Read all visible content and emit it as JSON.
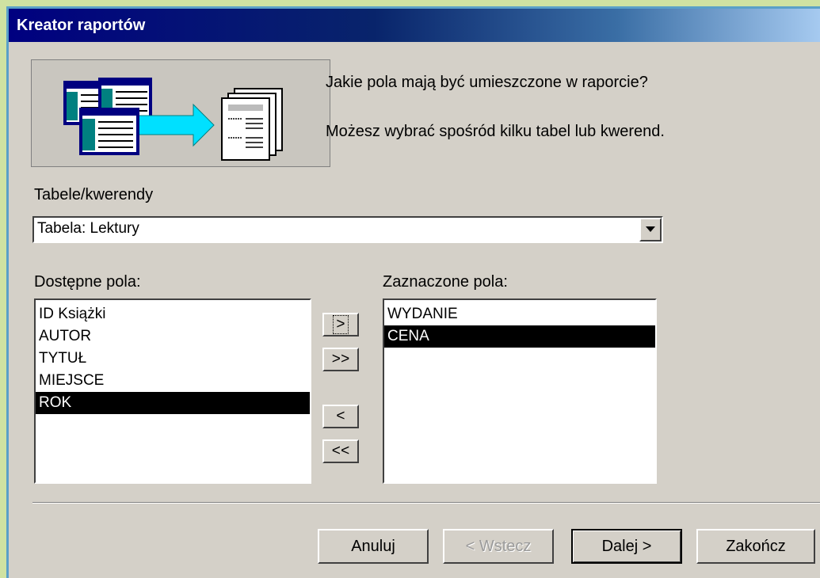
{
  "window": {
    "title": "Kreator raportów"
  },
  "header": {
    "question": "Jakie pola mają być umieszczone w raporcie?",
    "hint": "Możesz wybrać spośród kilku tabel lub kwerend."
  },
  "source": {
    "label": "Tabele/kwerendy",
    "value": "Tabela: Lektury"
  },
  "available": {
    "label": "Dostępne pola:",
    "items": [
      "ID Książki",
      "AUTOR",
      "TYTUŁ",
      "MIEJSCE",
      "ROK"
    ],
    "selected_index": 4
  },
  "chosen": {
    "label": "Zaznaczone pola:",
    "items": [
      "WYDANIE",
      "CENA"
    ],
    "selected_index": 1
  },
  "move_buttons": {
    "add_one": ">",
    "add_all": ">>",
    "remove_one": "<",
    "remove_all": "<<"
  },
  "footer": {
    "cancel": "Anuluj",
    "back": "< Wstecz",
    "next": "Dalej >",
    "finish": "Zakończ"
  }
}
